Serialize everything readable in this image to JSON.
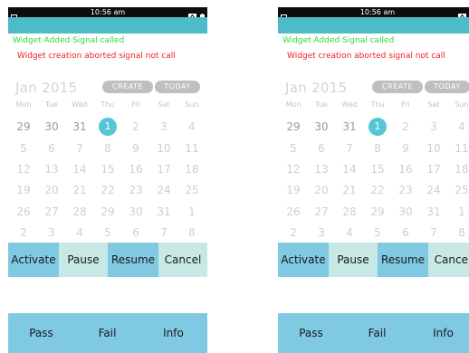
{
  "status_bar": {
    "time": "10:56 am"
  },
  "messages": {
    "widget_added": "Widget Added Signal called",
    "widget_aborted": "Widget creation aborted signal not call"
  },
  "calendar": {
    "month_year": "Jan 2015",
    "create_label": "CREATE",
    "today_label": "TODAY",
    "weekdays": [
      "Mon",
      "Tue",
      "Wed",
      "Thu",
      "Fri",
      "Sat",
      "Sun"
    ],
    "selected_day": "1",
    "weeks": [
      [
        {
          "d": "29",
          "m": "cur"
        },
        {
          "d": "30",
          "m": "cur"
        },
        {
          "d": "31",
          "m": "cur"
        },
        {
          "d": "1",
          "m": "sel"
        },
        {
          "d": "2",
          "m": "dim"
        },
        {
          "d": "3",
          "m": "dim"
        },
        {
          "d": "4",
          "m": "dim"
        }
      ],
      [
        {
          "d": "5",
          "m": "dim"
        },
        {
          "d": "6",
          "m": "dim"
        },
        {
          "d": "7",
          "m": "dim"
        },
        {
          "d": "8",
          "m": "dim"
        },
        {
          "d": "9",
          "m": "dim"
        },
        {
          "d": "10",
          "m": "dim"
        },
        {
          "d": "11",
          "m": "dim"
        }
      ],
      [
        {
          "d": "12",
          "m": "dim"
        },
        {
          "d": "13",
          "m": "dim"
        },
        {
          "d": "14",
          "m": "dim"
        },
        {
          "d": "15",
          "m": "dim"
        },
        {
          "d": "16",
          "m": "dim"
        },
        {
          "d": "17",
          "m": "dim"
        },
        {
          "d": "18",
          "m": "dim"
        }
      ],
      [
        {
          "d": "19",
          "m": "dim"
        },
        {
          "d": "20",
          "m": "dim"
        },
        {
          "d": "21",
          "m": "dim"
        },
        {
          "d": "22",
          "m": "dim"
        },
        {
          "d": "23",
          "m": "dim"
        },
        {
          "d": "24",
          "m": "dim"
        },
        {
          "d": "25",
          "m": "dim"
        }
      ],
      [
        {
          "d": "26",
          "m": "dim"
        },
        {
          "d": "27",
          "m": "dim"
        },
        {
          "d": "28",
          "m": "dim"
        },
        {
          "d": "29",
          "m": "dim"
        },
        {
          "d": "30",
          "m": "dim"
        },
        {
          "d": "31",
          "m": "dim"
        },
        {
          "d": "1",
          "m": "dim"
        }
      ],
      [
        {
          "d": "2",
          "m": "dim"
        },
        {
          "d": "3",
          "m": "dim"
        },
        {
          "d": "4",
          "m": "dim"
        },
        {
          "d": "5",
          "m": "dim"
        },
        {
          "d": "6",
          "m": "dim"
        },
        {
          "d": "7",
          "m": "dim"
        },
        {
          "d": "8",
          "m": "dim"
        }
      ]
    ]
  },
  "controls": {
    "activate": "Activate",
    "pause": "Pause",
    "resume": "Resume",
    "cancel": "Cancel"
  },
  "bottom_bar": {
    "pass": "Pass",
    "fail": "Fail",
    "info": "Info"
  },
  "colors": {
    "titlebar": "#4dbbc8",
    "signal_ok": "#35d93a",
    "signal_error": "#f21e1e",
    "today_highlight": "#55c6d6",
    "button_blue": "#80c9e2",
    "button_pale": "#c7e8e4"
  },
  "icons": {
    "status_left": "notification-icon",
    "status_right": [
      "sync-icon",
      "battery-icon"
    ]
  }
}
